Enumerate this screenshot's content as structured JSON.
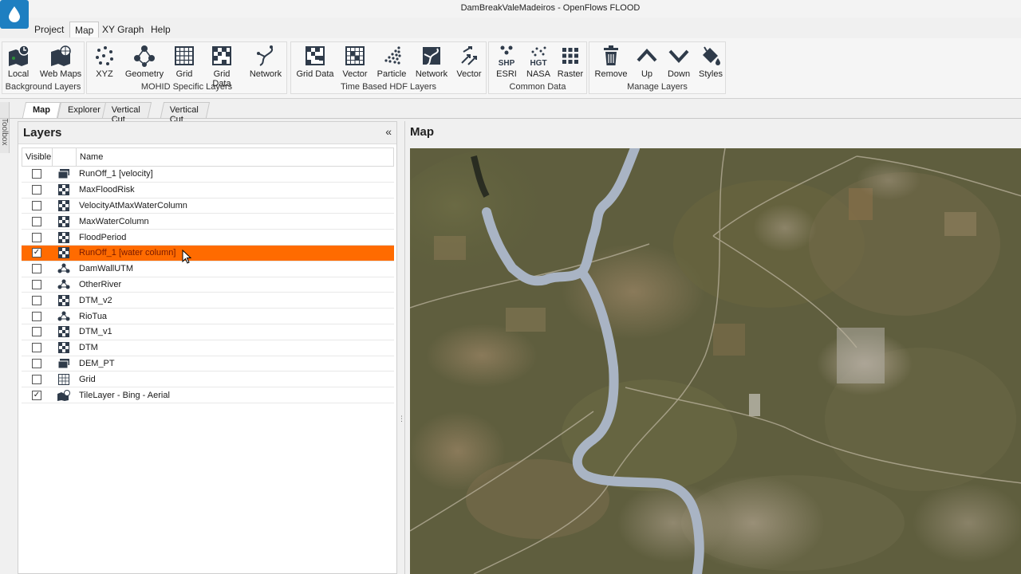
{
  "window": {
    "title": "DamBreakValeMadeiros - OpenFlows FLOOD"
  },
  "menu": {
    "items": [
      {
        "label": "Project"
      },
      {
        "label": "Map"
      },
      {
        "label": "XY Graph"
      },
      {
        "label": "Help"
      }
    ]
  },
  "ribbon": {
    "groups": [
      {
        "label": "Background Layers",
        "buttons": [
          {
            "label": "Local",
            "icon": "local-map-icon"
          },
          {
            "label": "Web Maps",
            "icon": "web-maps-icon"
          }
        ]
      },
      {
        "label": "MOHID Specific Layers",
        "buttons": [
          {
            "label": "XYZ",
            "icon": "xyz-points-icon"
          },
          {
            "label": "Geometry",
            "icon": "geometry-icon"
          },
          {
            "label": "Grid",
            "icon": "grid-icon"
          },
          {
            "label": "Grid Data",
            "icon": "grid-data-icon"
          },
          {
            "label": "Network",
            "icon": "network-icon"
          }
        ]
      },
      {
        "label": "Time Based HDF Layers",
        "buttons": [
          {
            "label": "Grid Data",
            "icon": "hdf-grid-data-icon"
          },
          {
            "label": "Vector",
            "icon": "hdf-vector-icon"
          },
          {
            "label": "Particle",
            "icon": "particle-icon"
          },
          {
            "label": "Network",
            "icon": "hdf-network-icon"
          },
          {
            "label": "Vector",
            "icon": "vector-arrows-icon"
          }
        ]
      },
      {
        "label": "Common Data",
        "buttons": [
          {
            "label": "ESRI",
            "icon": "shp-icon",
            "badge": "SHP"
          },
          {
            "label": "NASA",
            "icon": "hgt-icon",
            "badge": "HGT"
          },
          {
            "label": "Raster",
            "icon": "raster-icon"
          }
        ]
      },
      {
        "label": "Manage Layers",
        "buttons": [
          {
            "label": "Remove",
            "icon": "trash-icon"
          },
          {
            "label": "Up",
            "icon": "chevron-up-icon"
          },
          {
            "label": "Down",
            "icon": "chevron-down-icon"
          },
          {
            "label": "Styles",
            "icon": "paint-bucket-icon"
          }
        ]
      }
    ]
  },
  "doc_tabs": [
    {
      "label": "Map",
      "active": true
    },
    {
      "label": "Explorer",
      "active": false
    },
    {
      "label": "Vertical Cut",
      "active": false
    },
    {
      "label": "Vertical Cut",
      "active": false
    }
  ],
  "toolbox": {
    "label": "Toolbox"
  },
  "layers": {
    "title": "Layers",
    "collapse_glyph": "«",
    "columns": {
      "visible": "Visible",
      "name": "Name"
    },
    "rows": [
      {
        "name": "RunOff_1 [velocity]",
        "checked": false,
        "icon": "stack-layer-icon",
        "selected": false
      },
      {
        "name": "MaxFloodRisk",
        "checked": false,
        "icon": "grid-data-icon",
        "selected": false
      },
      {
        "name": "VelocityAtMaxWaterColumn",
        "checked": false,
        "icon": "grid-data-icon",
        "selected": false
      },
      {
        "name": "MaxWaterColumn",
        "checked": false,
        "icon": "grid-data-icon",
        "selected": false
      },
      {
        "name": "FloodPeriod",
        "checked": false,
        "icon": "grid-data-icon",
        "selected": false
      },
      {
        "name": "RunOff_1 [water column]",
        "checked": true,
        "icon": "grid-data-icon",
        "selected": true
      },
      {
        "name": "DamWallUTM",
        "checked": false,
        "icon": "geometry-icon",
        "selected": false
      },
      {
        "name": "OtherRiver",
        "checked": false,
        "icon": "geometry-icon",
        "selected": false
      },
      {
        "name": "DTM_v2",
        "checked": false,
        "icon": "grid-data-icon",
        "selected": false
      },
      {
        "name": "RioTua",
        "checked": false,
        "icon": "geometry-icon",
        "selected": false
      },
      {
        "name": "DTM_v1",
        "checked": false,
        "icon": "grid-data-icon",
        "selected": false
      },
      {
        "name": "DTM",
        "checked": false,
        "icon": "grid-data-icon",
        "selected": false
      },
      {
        "name": "DEM_PT",
        "checked": false,
        "icon": "stack-layer-icon",
        "selected": false
      },
      {
        "name": "Grid",
        "checked": false,
        "icon": "grid-icon",
        "selected": false
      },
      {
        "name": "TileLayer - Bing - Aerial",
        "checked": true,
        "icon": "web-maps-icon",
        "selected": false
      }
    ]
  },
  "map": {
    "title": "Map"
  },
  "colors": {
    "selection": "#ff6b00",
    "accent": "#1e7fc1",
    "river": "#a9b4c4"
  }
}
